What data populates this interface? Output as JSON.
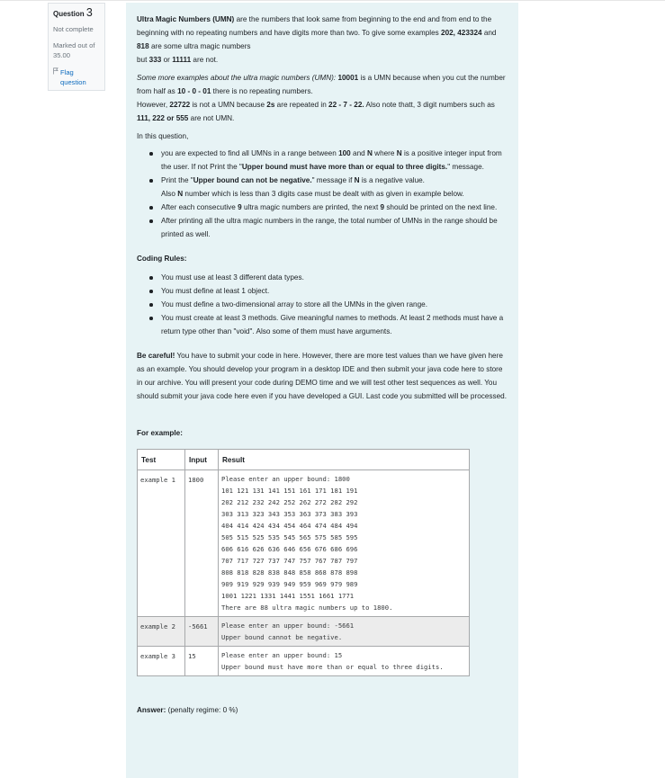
{
  "question_info": {
    "label": "Question",
    "number": "3",
    "state": "Not complete",
    "grade": "Marked out of 35.00",
    "flag_label": "Flag question"
  },
  "question_text": {
    "intro": {
      "title": "Ultra Magic Numbers",
      "abbr": "(UMN)",
      "text1": " are the numbers that look same from beginning to the end and from end to the beginning with no repeating numbers and have digits more than two. To give some examples ",
      "bold1": "202, 423324",
      "text2": " and ",
      "bold2": "818",
      "text3": " are some ultra magic numbers",
      "text4": "but ",
      "bold3": "333",
      "text5": " or ",
      "bold4": "11111",
      "text6": " are not."
    },
    "more_examples": {
      "italic": "Some more examples about the ultra magic numbers (UMN):",
      "bold1": "10001",
      "text1": " is a UMN because when you cut the number from half as ",
      "bold2": "10 - 0 - 01",
      "text2": " there is no repeating numbers.",
      "text3": "However, ",
      "bold3": "22722",
      "text4": " is not a UMN because ",
      "bold4": "2s",
      "text5": " are repeated in ",
      "bold5": "22 - 7 - 22.",
      "text6": " Also note thatt, 3 digit numbers such as ",
      "bold6": "111, 222 or 555",
      "text7": " are not UMN."
    },
    "in_this_question": "In this question,",
    "bullets": {
      "b1_t1": "you are expected to find all UMNs in a range between ",
      "b1_b1": "100",
      "b1_t2": " and ",
      "b1_b2": "N",
      "b1_t3": " where ",
      "b1_b3": "N",
      "b1_t4": " is a positive integer input from the user. If not Print the \"",
      "b1_b4": "Upper bound must have more than or equal to three digits.",
      "b1_t5": "\" message.",
      "b2_t1": "Print the \"",
      "b2_b1": "Upper bound can not be negative.",
      "b2_t2": "\" message if ",
      "b2_b2": "N",
      "b2_t3": " is a negative value.",
      "b2_t4": "Also ",
      "b2_b3": "N",
      "b2_t5": " number which is less than 3 digits case must be dealt with as given in example below.",
      "b3_t1": "After each consecutive ",
      "b3_b1": "9",
      "b3_t2": " ultra magic numbers are printed, the next ",
      "b3_b2": "9",
      "b3_t3": " should be printed on the next line.",
      "b4": "After printing all the ultra magic numbers in the range, the total number of UMNs in the range should be printed as well."
    },
    "coding_rules_title": "Coding Rules:",
    "coding_rules": [
      "You must use at least 3 different data types.",
      "You must define at least 1 object.",
      "You must define a two-dimensional array to store all the UMNs in the given range.",
      "You must create at least 3 methods. Give meaningful names to methods. At least 2 methods must have a return type other than \"void\". Also some of them must have arguments."
    ],
    "careful_bold": "Be careful!",
    "careful_text": " You have to submit your code in here. However, there are more test values than we have given here as an example. You should develop your program in a desktop IDE and then submit your java code here to store in our archive. You will present your code during DEMO time and we will test other test sequences as well. You should submit your java code here even if you have developed a GUI. Last code you submitted will be processed.",
    "for_example": "For example:"
  },
  "examples_table": {
    "headers": [
      "Test",
      "Input",
      "Result"
    ],
    "rows": [
      {
        "test": "example 1",
        "input": "1800",
        "result": "Please enter an upper bound: 1800\n101 121 131 141 151 161 171 181 191\n202 212 232 242 252 262 272 282 292\n303 313 323 343 353 363 373 383 393\n404 414 424 434 454 464 474 484 494\n505 515 525 535 545 565 575 585 595\n606 616 626 636 646 656 676 686 696\n707 717 727 737 747 757 767 787 797\n808 818 828 838 848 858 868 878 898\n909 919 929 939 949 959 969 979 989\n1001 1221 1331 1441 1551 1661 1771\nThere are 88 ultra magic numbers up to 1800."
      },
      {
        "test": "example 2",
        "input": "-5661",
        "result": "Please enter an upper bound: -5661\nUpper bound cannot be negative."
      },
      {
        "test": "example 3",
        "input": "15",
        "result": "Please enter an upper bound: 15\nUpper bound must have more than or equal to three digits."
      }
    ]
  },
  "answer": {
    "label": "Answer:",
    "penalty": " (penalty regime: 0 %)"
  }
}
